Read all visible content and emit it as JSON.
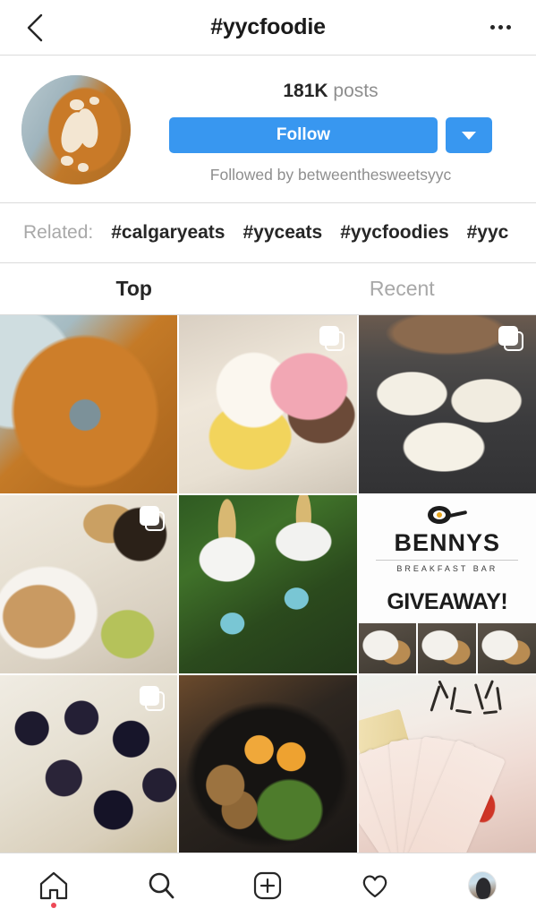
{
  "header": {
    "title": "#yycfoodie",
    "back_icon": "chevron-left-icon",
    "more_icon": "ellipsis-icon"
  },
  "profile": {
    "avatar_alt": "caramel-glazed-donut-with-coconut",
    "post_count": "181K",
    "post_label": "posts",
    "follow_label": "Follow",
    "follow_dropdown_icon": "chevron-down-icon",
    "followed_by": "Followed by betweenthesweetsyyc",
    "accent_color": "#3897f0"
  },
  "related": {
    "label": "Related:",
    "tags": [
      "#calgaryeats",
      "#yyceats",
      "#yycfoodies",
      "#yyc"
    ]
  },
  "tabs": [
    {
      "label": "Top",
      "active": true
    },
    {
      "label": "Recent",
      "active": false
    }
  ],
  "grid": {
    "rows": [
      [
        {
          "name": "post-donut",
          "alt": "caramel glazed donut with coconut flakes on blue plate",
          "multi": false
        },
        {
          "name": "post-lemon-dessert",
          "alt": "lemon meringue dessert with macarons",
          "multi": true
        },
        {
          "name": "post-tacos",
          "alt": "tacos in white takeout containers",
          "multi": true
        }
      ],
      [
        {
          "name": "post-brunch",
          "alt": "waffles avocado toast and black coffee flat lay",
          "multi": true
        },
        {
          "name": "post-drink-jars",
          "alt": "two jar cups with bamboo straws in garden",
          "multi": false
        },
        {
          "name": "post-bennys-giveaway",
          "alt": "Bennys Breakfast Bar giveaway graphic",
          "multi": false
        }
      ],
      [
        {
          "name": "post-berry-tarts",
          "alt": "mini cheesecakes with dark berry topping",
          "multi": true
        },
        {
          "name": "post-ramen",
          "alt": "ramen bowl with soft boiled egg and pork",
          "multi": false
        },
        {
          "name": "post-drink-cards",
          "alt": "fanned cocktail cards with deer line art",
          "multi": false
        }
      ]
    ],
    "bennys": {
      "name": "BENNYS",
      "subtitle": "BREAKFAST BAR",
      "headline": "GIVEAWAY!"
    }
  },
  "bottom_nav": [
    {
      "name": "home",
      "icon": "home-icon",
      "badge": true
    },
    {
      "name": "search",
      "icon": "search-icon",
      "badge": false
    },
    {
      "name": "new-post",
      "icon": "plus-square-icon",
      "badge": false
    },
    {
      "name": "activity",
      "icon": "heart-icon",
      "badge": false
    },
    {
      "name": "profile",
      "icon": "avatar-icon",
      "badge": false
    }
  ]
}
